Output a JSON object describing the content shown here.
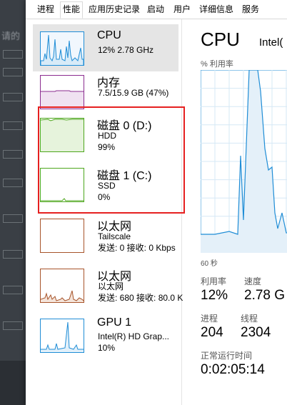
{
  "background_window": {
    "fragments": [
      "请的",
      "",
      "",
      "",
      "",
      ""
    ]
  },
  "tabs": [
    {
      "label": "进程",
      "active": false
    },
    {
      "label": "性能",
      "active": true
    },
    {
      "label": "应用历史记录",
      "active": false
    },
    {
      "label": "启动",
      "active": false
    },
    {
      "label": "用户",
      "active": false
    },
    {
      "label": "详细信息",
      "active": false
    },
    {
      "label": "服务",
      "active": false
    }
  ],
  "devices": [
    {
      "name": "CPU",
      "line1": "12% 2.78 GHz",
      "line2": "",
      "selected": true,
      "color": "#1f8dd6",
      "level": 0.12
    },
    {
      "name": "内存",
      "line1": "7.5/15.9 GB (47%)",
      "line2": "",
      "selected": false,
      "color": "#8b2c8f",
      "level": 0.47
    },
    {
      "name": "磁盘 0 (D:)",
      "line1": "HDD",
      "line2": "99%",
      "selected": false,
      "color": "#4da61c",
      "level": 0.99
    },
    {
      "name": "磁盘 1 (C:)",
      "line1": "SSD",
      "line2": "0%",
      "selected": false,
      "color": "#4da61c",
      "level": 0.0
    },
    {
      "name": "以太网",
      "line1": "Tailscale",
      "line2": "发送: 0 接收: 0 Kbps",
      "selected": false,
      "color": "#a7542a",
      "level": 0.0
    },
    {
      "name": "以太网",
      "line1": "以太网",
      "line2": "发送: 680 接收: 80.0 K",
      "selected": false,
      "color": "#a7542a",
      "level": 0.1
    },
    {
      "name": "GPU 1",
      "line1": "Intel(R) HD Grap...",
      "line2": "10%",
      "selected": false,
      "color": "#1f8dd6",
      "level": 0.1
    }
  ],
  "detail": {
    "title": "CPU",
    "model": "Intel(",
    "util_label": "% 利用率",
    "seconds_label": "60 秒",
    "stats": {
      "util_label": "利用率",
      "util_value": "12%",
      "speed_label": "速度",
      "speed_value": "2.78 G",
      "proc_label": "进程",
      "proc_value": "204",
      "thread_label": "线程",
      "thread_value": "2304",
      "uptime_label": "正常运行时间",
      "uptime_value": "0:02:05:14"
    }
  },
  "colors": {
    "cpu": "#1f8dd6",
    "memory": "#8b2c8f",
    "disk": "#4da61c",
    "ethernet": "#a7542a",
    "highlight_box": "#e62020",
    "selected_bg": "#e5e5e5"
  }
}
